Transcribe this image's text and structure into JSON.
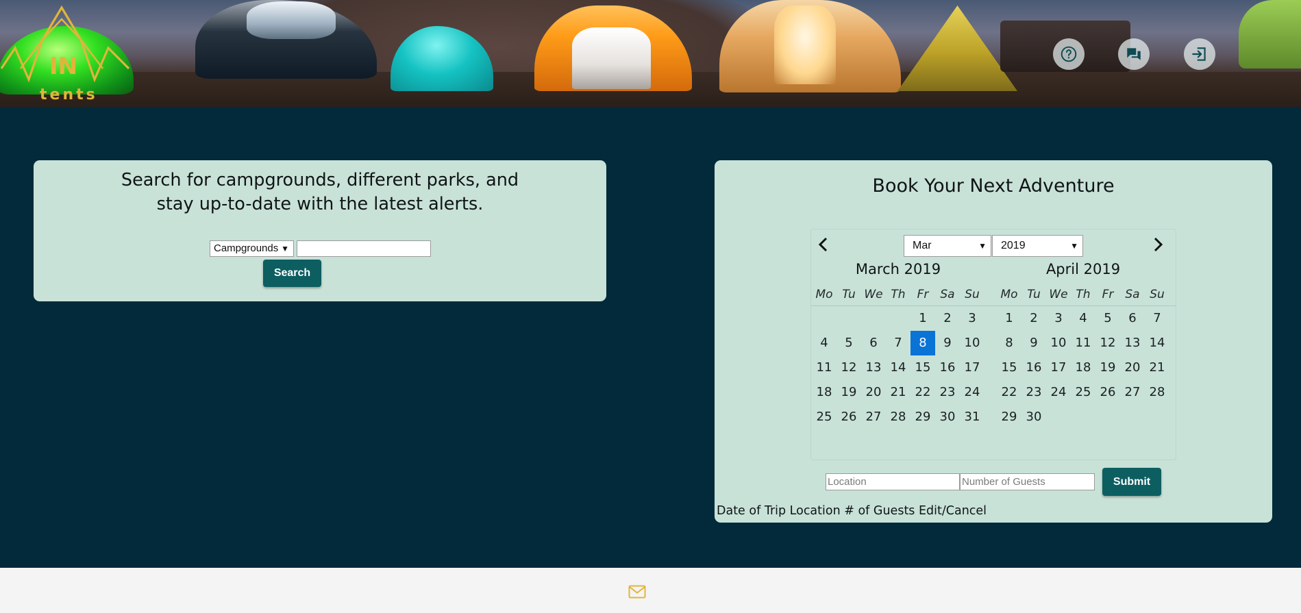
{
  "header": {
    "logo_text_top": "IN",
    "logo_text_bottom": "tents",
    "logo_color": "#e2b53a",
    "actions": [
      {
        "icon": "help-circle-icon",
        "label": ""
      },
      {
        "icon": "chat-icon",
        "label": ""
      },
      {
        "icon": "logout-icon",
        "label": ""
      }
    ]
  },
  "search": {
    "title_line1": "Search for campgrounds, different parks, and",
    "title_line2": "stay up-to-date with the latest alerts.",
    "category_selected": "Campgrounds",
    "query_value": "",
    "button_label": "Search"
  },
  "booking": {
    "title": "Book Your Next Adventure",
    "calendar": {
      "month_selected": "Mar",
      "year_selected": "2019",
      "selected_date": "2019-03-08",
      "weekdays": [
        "Mo",
        "Tu",
        "We",
        "Th",
        "Fr",
        "Sa",
        "Su"
      ],
      "months": [
        {
          "title": "March 2019",
          "weeks": [
            [
              "",
              "",
              "",
              "",
              "1",
              "2",
              "3"
            ],
            [
              "4",
              "5",
              "6",
              "7",
              "8",
              "9",
              "10"
            ],
            [
              "11",
              "12",
              "13",
              "14",
              "15",
              "16",
              "17"
            ],
            [
              "18",
              "19",
              "20",
              "21",
              "22",
              "23",
              "24"
            ],
            [
              "25",
              "26",
              "27",
              "28",
              "29",
              "30",
              "31"
            ]
          ]
        },
        {
          "title": "April 2019",
          "weeks": [
            [
              "1",
              "2",
              "3",
              "4",
              "5",
              "6",
              "7"
            ],
            [
              "8",
              "9",
              "10",
              "11",
              "12",
              "13",
              "14"
            ],
            [
              "15",
              "16",
              "17",
              "18",
              "19",
              "20",
              "21"
            ],
            [
              "22",
              "23",
              "24",
              "25",
              "26",
              "27",
              "28"
            ],
            [
              "29",
              "30",
              "",
              "",
              "",
              "",
              ""
            ]
          ]
        }
      ]
    },
    "location_placeholder": "Location",
    "guests_placeholder": "Number of Guests",
    "submit_label": "Submit",
    "table_header": "Date of Trip Location # of Guests Edit/Cancel"
  },
  "footer": {
    "icon": "mail-icon"
  },
  "colors": {
    "background": "#022a3a",
    "panel": "#c8e2d8",
    "button": "#0d5e61",
    "selected_day": "#0a73d6",
    "footer": "#f4f4f4",
    "mail_icon": "#e2b53a"
  }
}
